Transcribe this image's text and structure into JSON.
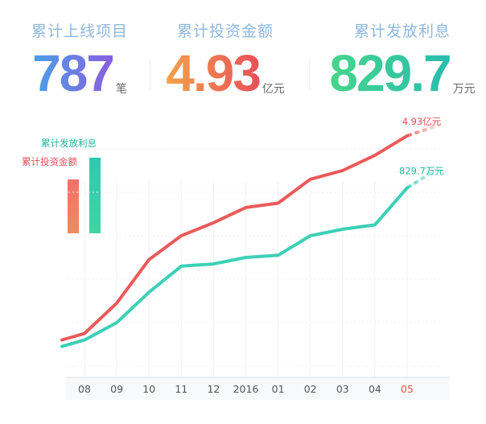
{
  "stats": [
    {
      "label": "累计上线项目",
      "value": "787",
      "unit": "笔"
    },
    {
      "label": "累计投资金额",
      "value": "4.93",
      "unit": "亿元"
    },
    {
      "label": "累计发放利息",
      "value": "829.7",
      "unit": "万元"
    }
  ],
  "legend": {
    "investment_label": "累计投资金额",
    "interest_label": "累计发放利息"
  },
  "colors": {
    "investment": "#ea5a5a",
    "interest": "#3dd0b6",
    "axis_text": "#555555",
    "axis_highlight": "#e85656"
  },
  "chart_data": {
    "type": "line",
    "categories": [
      "08",
      "09",
      "10",
      "11",
      "12",
      "2016",
      "01",
      "02",
      "03",
      "04",
      "05"
    ],
    "highlight_category": "05",
    "ylim": [
      0,
      10
    ],
    "series": [
      {
        "name": "累计投资金额",
        "values": [
          1.5,
          2.9,
          4.9,
          6.0,
          6.6,
          7.3,
          7.5,
          8.6,
          9.0,
          9.7,
          10.6
        ],
        "end_label": "4.93亿元"
      },
      {
        "name": "累计发放利息",
        "values": [
          1.2,
          2.0,
          3.4,
          4.6,
          4.7,
          5.0,
          5.1,
          6.0,
          6.3,
          6.5,
          8.2
        ],
        "end_label": "829.7万元"
      }
    ]
  }
}
